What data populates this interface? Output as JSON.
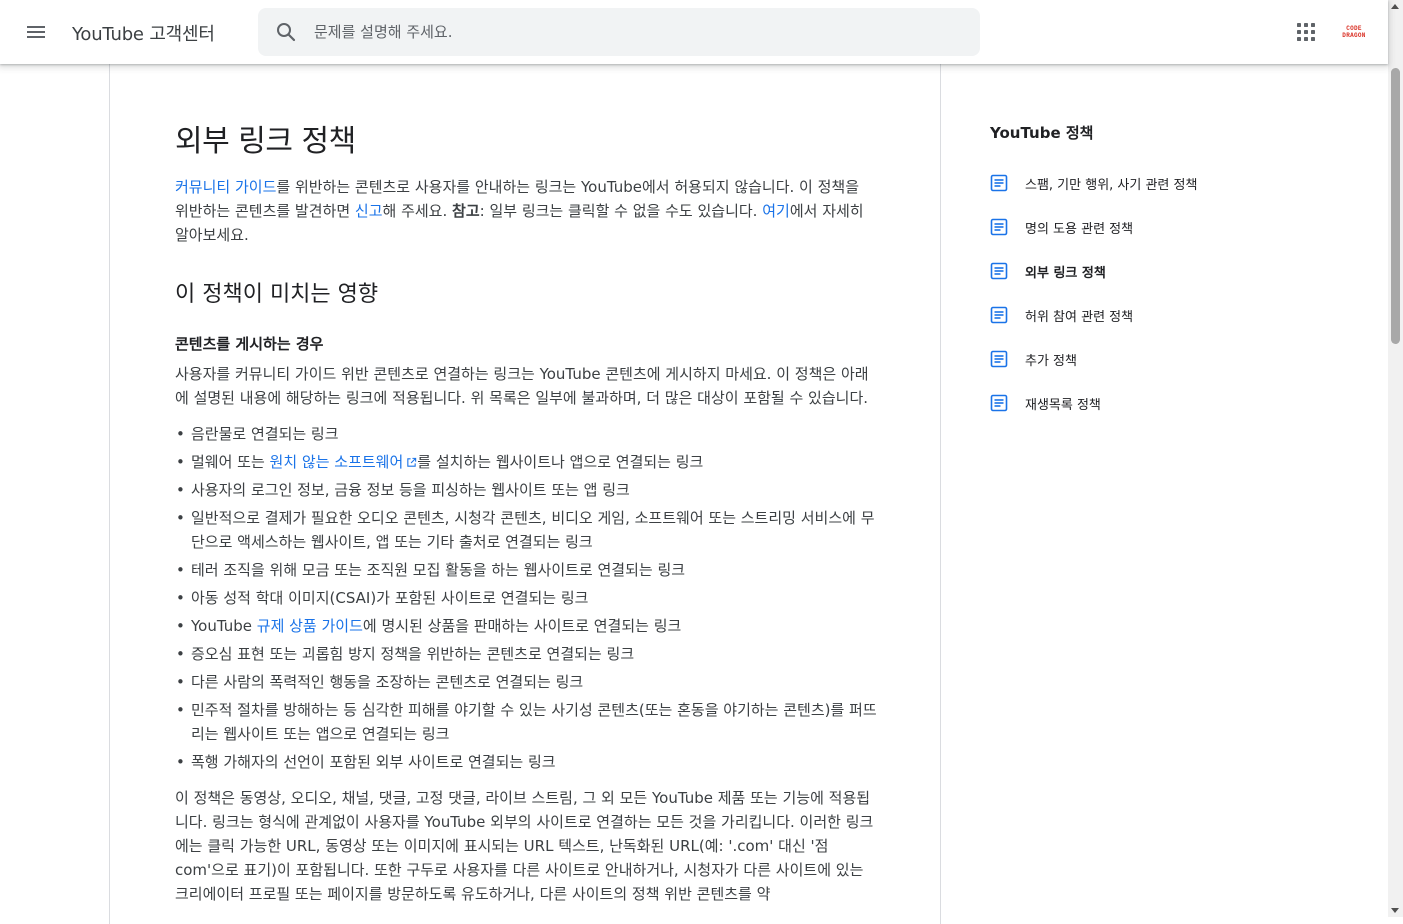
{
  "header": {
    "brand": "YouTube 고객센터",
    "search_placeholder": "문제를 설명해 주세요.",
    "avatar_text": [
      "CODE",
      "DRAGON"
    ]
  },
  "article": {
    "title": "외부 링크 정책",
    "intro": {
      "link1": "커뮤니티 가이드",
      "text1": "를 위반하는 콘텐츠로 사용자를 안내하는 링크는 YouTube에서 허용되지 않습니다. 이 정책을 위반하는 콘텐츠를 발견하면 ",
      "link2": "신고",
      "text2": "해 주세요. ",
      "bold": "참고",
      "text3": ": 일부 링크는 클릭할 수 없을 수도 있습니다. ",
      "link3": "여기",
      "text4": "에서 자세히 알아보세요."
    },
    "section_title": "이 정책이 미치는 영향",
    "subsection_title": "콘텐츠를 게시하는 경우",
    "subsection_para": "사용자를 커뮤니티 가이드 위반 콘텐츠로 연결하는 링크는 YouTube 콘텐츠에 게시하지 마세요. 이 정책은 아래에 설명된 내용에 해당하는 링크에 적용됩니다. 위 목록은 일부에 불과하며, 더 많은 대상이 포함될 수 있습니다.",
    "bullets": {
      "b1": "음란물로 연결되는 링크",
      "b2_pre": "멀웨어 또는 ",
      "b2_link": "원치 않는 소프트웨어",
      "b2_post": "를 설치하는 웹사이트나 앱으로 연결되는 링크",
      "b3": "사용자의 로그인 정보, 금융 정보 등을 피싱하는 웹사이트 또는 앱 링크",
      "b4": "일반적으로 결제가 필요한 오디오 콘텐츠, 시청각 콘텐츠, 비디오 게임, 소프트웨어 또는 스트리밍 서비스에 무단으로 액세스하는 웹사이트, 앱 또는 기타 출처로 연결되는 링크",
      "b5": "테러 조직을 위해 모금 또는 조직원 모집 활동을 하는 웹사이트로 연결되는 링크",
      "b6": "아동 성적 학대 이미지(CSAI)가 포함된 사이트로 연결되는 링크",
      "b7_pre": "YouTube ",
      "b7_link": "규제 상품 가이드",
      "b7_post": "에 명시된 상품을 판매하는 사이트로 연결되는 링크",
      "b8": "증오심 표현 또는 괴롭힘 방지 정책을 위반하는 콘텐츠로 연결되는 링크",
      "b9": "다른 사람의 폭력적인 행동을 조장하는 콘텐츠로 연결되는 링크",
      "b10": "민주적 절차를 방해하는 등 심각한 피해를 야기할 수 있는 사기성 콘텐츠(또는 혼동을 야기하는 콘텐츠)를 퍼뜨리는 웹사이트 또는 앱으로 연결되는 링크",
      "b11": "폭행 가해자의 선언이 포함된 외부 사이트로 연결되는 링크"
    },
    "closing_para": "이 정책은 동영상, 오디오, 채널, 댓글, 고정 댓글, 라이브 스트림, 그 외 모든 YouTube 제품 또는 기능에 적용됩니다. 링크는 형식에 관계없이 사용자를 YouTube 외부의 사이트로 연결하는 모든 것을 가리킵니다. 이러한 링크에는 클릭 가능한 URL, 동영상 또는 이미지에 표시되는 URL 텍스트, 난독화된 URL(예: '.com' 대신 '점 com'으로 표기)이 포함됩니다. 또한 구두로 사용자를 다른 사이트로 안내하거나, 시청자가 다른 사이트에 있는 크리에이터 프로필 또는 페이지를 방문하도록 유도하거나, 다른 사이트의 정책 위반 콘텐츠를 약"
  },
  "rightnav": {
    "title": "YouTube 정책",
    "items": [
      {
        "label": "스팸, 기만 행위, 사기 관련 정책",
        "icon": "document-icon",
        "active": false
      },
      {
        "label": "명의 도용 관련 정책",
        "icon": "document-icon",
        "active": false
      },
      {
        "label": "외부 링크 정책",
        "icon": "document-icon",
        "active": true
      },
      {
        "label": "허위 참여 관련 정책",
        "icon": "document-icon",
        "active": false
      },
      {
        "label": "추가 정책",
        "icon": "document-icon",
        "active": false
      },
      {
        "label": "재생목록 정책",
        "icon": "document-icon",
        "active": false
      }
    ]
  },
  "colors": {
    "link": "#1a73e8",
    "icon_blue": "#1a73e8",
    "text": "#3c4043",
    "heading": "#202124",
    "search_bg": "#f1f3f4"
  }
}
